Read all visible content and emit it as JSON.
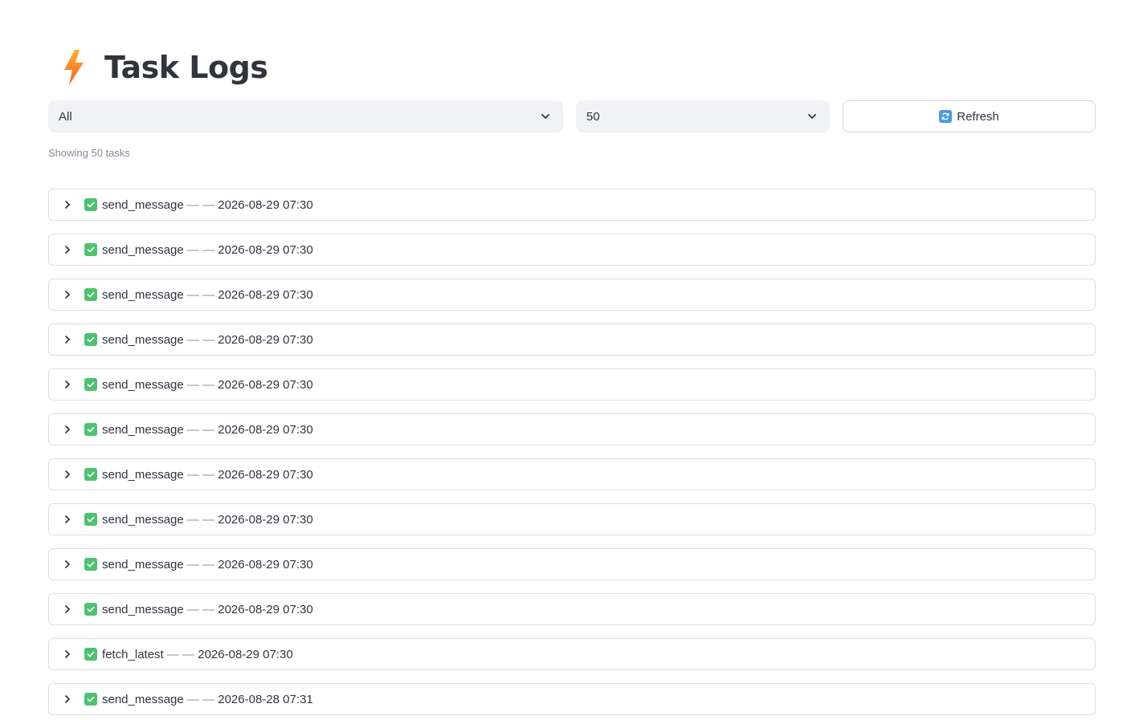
{
  "header": {
    "icon": "lightning-bolt-icon",
    "title": "Task Logs"
  },
  "controls": {
    "status_filter": {
      "selected": "All"
    },
    "limit_select": {
      "selected": "50"
    },
    "refresh_button": {
      "label": "Refresh",
      "icon": "refresh-icon"
    }
  },
  "caption": "Showing 50 tasks",
  "colors": {
    "check": "#4cc36f",
    "refresh_icon": "#4a9be8",
    "select_bg": "#f0f2f6",
    "border": "#dcdee4"
  },
  "tasks": [
    {
      "name": "send_message",
      "sep": "— —",
      "timestamp": "2026-08-29 07:30"
    },
    {
      "name": "send_message",
      "sep": "— —",
      "timestamp": "2026-08-29 07:30"
    },
    {
      "name": "send_message",
      "sep": "— —",
      "timestamp": "2026-08-29 07:30"
    },
    {
      "name": "send_message",
      "sep": "— —",
      "timestamp": "2026-08-29 07:30"
    },
    {
      "name": "send_message",
      "sep": "— —",
      "timestamp": "2026-08-29 07:30"
    },
    {
      "name": "send_message",
      "sep": "— —",
      "timestamp": "2026-08-29 07:30"
    },
    {
      "name": "send_message",
      "sep": "— —",
      "timestamp": "2026-08-29 07:30"
    },
    {
      "name": "send_message",
      "sep": "— —",
      "timestamp": "2026-08-29 07:30"
    },
    {
      "name": "send_message",
      "sep": "— —",
      "timestamp": "2026-08-29 07:30"
    },
    {
      "name": "send_message",
      "sep": "— —",
      "timestamp": "2026-08-29 07:30"
    },
    {
      "name": "fetch_latest",
      "sep": "— —",
      "timestamp": "2026-08-29 07:30"
    },
    {
      "name": "send_message",
      "sep": "— —",
      "timestamp": "2026-08-28 07:31"
    }
  ]
}
